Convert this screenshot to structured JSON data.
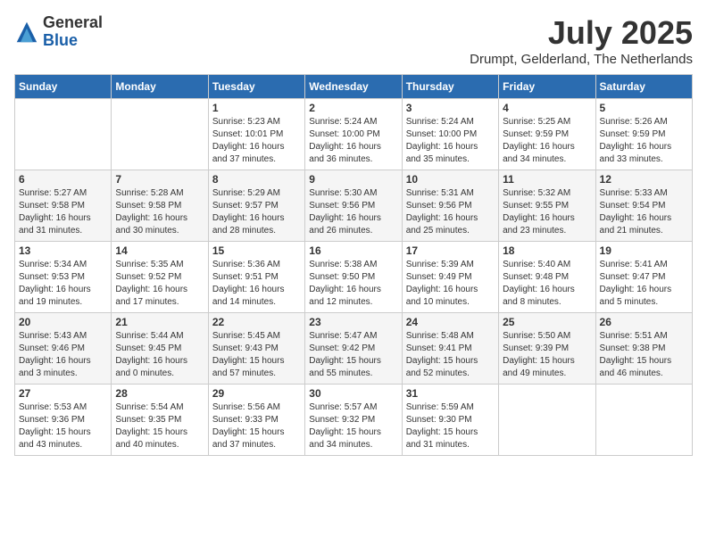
{
  "header": {
    "logo_general": "General",
    "logo_blue": "Blue",
    "month": "July 2025",
    "location": "Drumpt, Gelderland, The Netherlands"
  },
  "days_of_week": [
    "Sunday",
    "Monday",
    "Tuesday",
    "Wednesday",
    "Thursday",
    "Friday",
    "Saturday"
  ],
  "weeks": [
    [
      {
        "day": "",
        "info": ""
      },
      {
        "day": "",
        "info": ""
      },
      {
        "day": "1",
        "info": "Sunrise: 5:23 AM\nSunset: 10:01 PM\nDaylight: 16 hours and 37 minutes."
      },
      {
        "day": "2",
        "info": "Sunrise: 5:24 AM\nSunset: 10:00 PM\nDaylight: 16 hours and 36 minutes."
      },
      {
        "day": "3",
        "info": "Sunrise: 5:24 AM\nSunset: 10:00 PM\nDaylight: 16 hours and 35 minutes."
      },
      {
        "day": "4",
        "info": "Sunrise: 5:25 AM\nSunset: 9:59 PM\nDaylight: 16 hours and 34 minutes."
      },
      {
        "day": "5",
        "info": "Sunrise: 5:26 AM\nSunset: 9:59 PM\nDaylight: 16 hours and 33 minutes."
      }
    ],
    [
      {
        "day": "6",
        "info": "Sunrise: 5:27 AM\nSunset: 9:58 PM\nDaylight: 16 hours and 31 minutes."
      },
      {
        "day": "7",
        "info": "Sunrise: 5:28 AM\nSunset: 9:58 PM\nDaylight: 16 hours and 30 minutes."
      },
      {
        "day": "8",
        "info": "Sunrise: 5:29 AM\nSunset: 9:57 PM\nDaylight: 16 hours and 28 minutes."
      },
      {
        "day": "9",
        "info": "Sunrise: 5:30 AM\nSunset: 9:56 PM\nDaylight: 16 hours and 26 minutes."
      },
      {
        "day": "10",
        "info": "Sunrise: 5:31 AM\nSunset: 9:56 PM\nDaylight: 16 hours and 25 minutes."
      },
      {
        "day": "11",
        "info": "Sunrise: 5:32 AM\nSunset: 9:55 PM\nDaylight: 16 hours and 23 minutes."
      },
      {
        "day": "12",
        "info": "Sunrise: 5:33 AM\nSunset: 9:54 PM\nDaylight: 16 hours and 21 minutes."
      }
    ],
    [
      {
        "day": "13",
        "info": "Sunrise: 5:34 AM\nSunset: 9:53 PM\nDaylight: 16 hours and 19 minutes."
      },
      {
        "day": "14",
        "info": "Sunrise: 5:35 AM\nSunset: 9:52 PM\nDaylight: 16 hours and 17 minutes."
      },
      {
        "day": "15",
        "info": "Sunrise: 5:36 AM\nSunset: 9:51 PM\nDaylight: 16 hours and 14 minutes."
      },
      {
        "day": "16",
        "info": "Sunrise: 5:38 AM\nSunset: 9:50 PM\nDaylight: 16 hours and 12 minutes."
      },
      {
        "day": "17",
        "info": "Sunrise: 5:39 AM\nSunset: 9:49 PM\nDaylight: 16 hours and 10 minutes."
      },
      {
        "day": "18",
        "info": "Sunrise: 5:40 AM\nSunset: 9:48 PM\nDaylight: 16 hours and 8 minutes."
      },
      {
        "day": "19",
        "info": "Sunrise: 5:41 AM\nSunset: 9:47 PM\nDaylight: 16 hours and 5 minutes."
      }
    ],
    [
      {
        "day": "20",
        "info": "Sunrise: 5:43 AM\nSunset: 9:46 PM\nDaylight: 16 hours and 3 minutes."
      },
      {
        "day": "21",
        "info": "Sunrise: 5:44 AM\nSunset: 9:45 PM\nDaylight: 16 hours and 0 minutes."
      },
      {
        "day": "22",
        "info": "Sunrise: 5:45 AM\nSunset: 9:43 PM\nDaylight: 15 hours and 57 minutes."
      },
      {
        "day": "23",
        "info": "Sunrise: 5:47 AM\nSunset: 9:42 PM\nDaylight: 15 hours and 55 minutes."
      },
      {
        "day": "24",
        "info": "Sunrise: 5:48 AM\nSunset: 9:41 PM\nDaylight: 15 hours and 52 minutes."
      },
      {
        "day": "25",
        "info": "Sunrise: 5:50 AM\nSunset: 9:39 PM\nDaylight: 15 hours and 49 minutes."
      },
      {
        "day": "26",
        "info": "Sunrise: 5:51 AM\nSunset: 9:38 PM\nDaylight: 15 hours and 46 minutes."
      }
    ],
    [
      {
        "day": "27",
        "info": "Sunrise: 5:53 AM\nSunset: 9:36 PM\nDaylight: 15 hours and 43 minutes."
      },
      {
        "day": "28",
        "info": "Sunrise: 5:54 AM\nSunset: 9:35 PM\nDaylight: 15 hours and 40 minutes."
      },
      {
        "day": "29",
        "info": "Sunrise: 5:56 AM\nSunset: 9:33 PM\nDaylight: 15 hours and 37 minutes."
      },
      {
        "day": "30",
        "info": "Sunrise: 5:57 AM\nSunset: 9:32 PM\nDaylight: 15 hours and 34 minutes."
      },
      {
        "day": "31",
        "info": "Sunrise: 5:59 AM\nSunset: 9:30 PM\nDaylight: 15 hours and 31 minutes."
      },
      {
        "day": "",
        "info": ""
      },
      {
        "day": "",
        "info": ""
      }
    ]
  ]
}
